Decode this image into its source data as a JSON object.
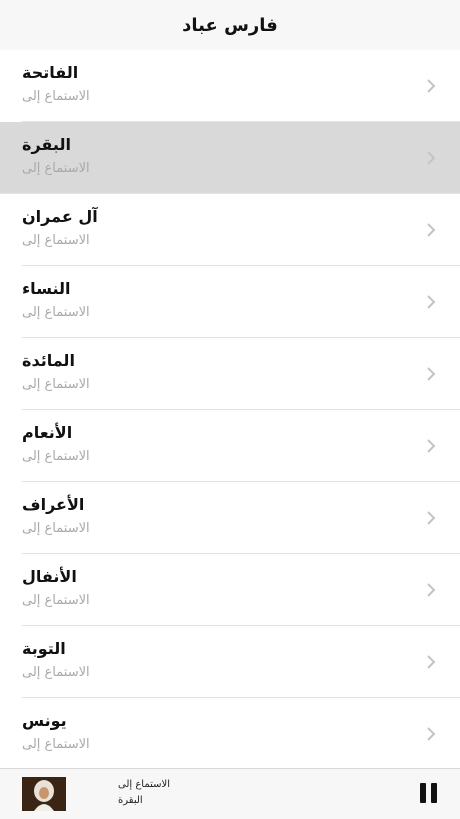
{
  "header": {
    "title": "فارس عباد"
  },
  "surahs": [
    {
      "title": "الفاتحة",
      "subtitle": "الاستماع إلى"
    },
    {
      "title": "البقرة",
      "subtitle": "الاستماع إلى",
      "selected": true
    },
    {
      "title": "آل عمران",
      "subtitle": "الاستماع إلى"
    },
    {
      "title": "النساء",
      "subtitle": "الاستماع إلى"
    },
    {
      "title": "المائدة",
      "subtitle": "الاستماع إلى"
    },
    {
      "title": "الأنعام",
      "subtitle": "الاستماع إلى"
    },
    {
      "title": "الأعراف",
      "subtitle": "الاستماع إلى"
    },
    {
      "title": "الأنفال",
      "subtitle": "الاستماع إلى"
    },
    {
      "title": "التوبة",
      "subtitle": "الاستماع إلى"
    },
    {
      "title": "يونس",
      "subtitle": "الاستماع إلى"
    }
  ],
  "player": {
    "line1": "الاستماع إلى",
    "line2": "البقرة",
    "state_icon": "pause-icon"
  },
  "colors": {
    "selected_row": "#d9d9d9",
    "subtitle": "#a9a9a9",
    "chevron": "#c4c4c4"
  }
}
